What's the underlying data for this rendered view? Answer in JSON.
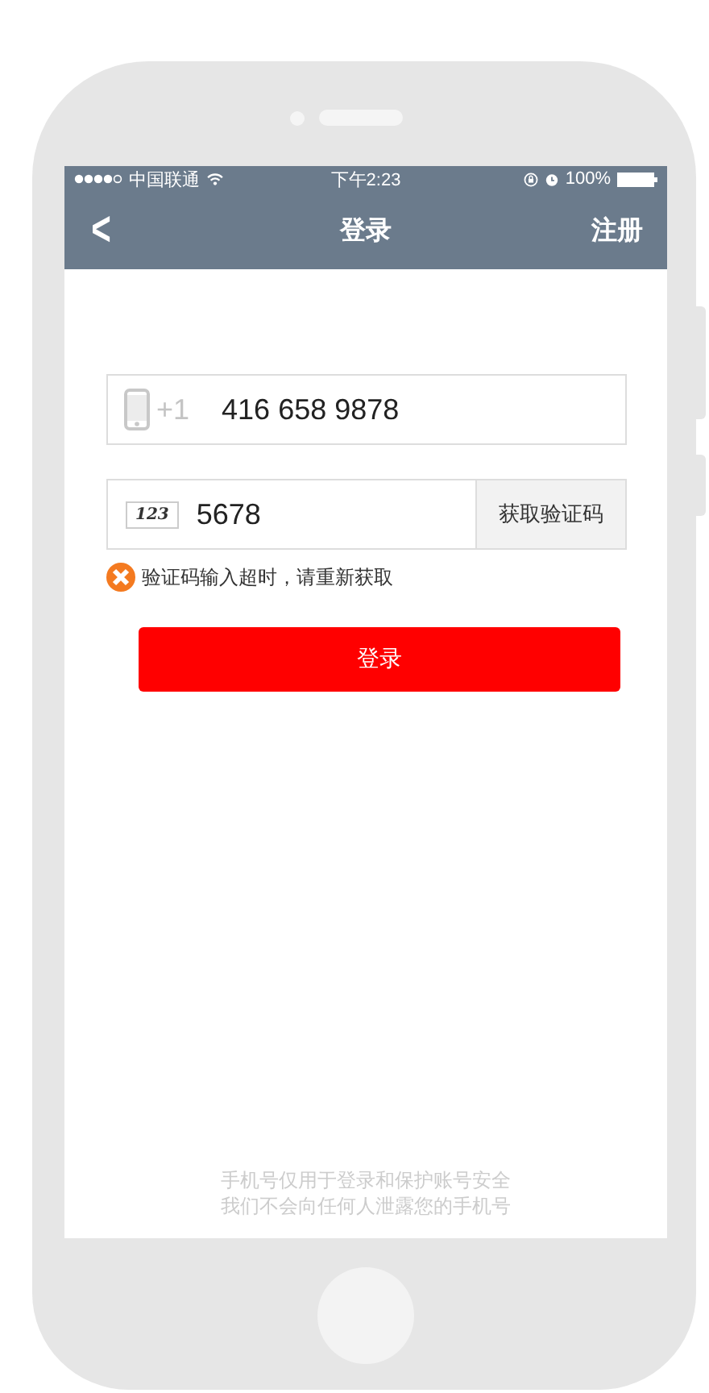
{
  "status_bar": {
    "carrier": "中国联通",
    "time": "下午2:23",
    "battery": "100%"
  },
  "nav": {
    "back": "<",
    "title": "登录",
    "action": "注册"
  },
  "phone_field": {
    "country_code": "+1",
    "value": "416 658 9878"
  },
  "code_field": {
    "icon_label": "123",
    "value": "5678",
    "button": "获取验证码"
  },
  "error": {
    "text": "验证码输入超时，请重新获取"
  },
  "login_button": "登录",
  "footer": [
    "手机号仅用于登录和保护账号安全",
    "我们不会向任何人泄露您的手机号"
  ]
}
